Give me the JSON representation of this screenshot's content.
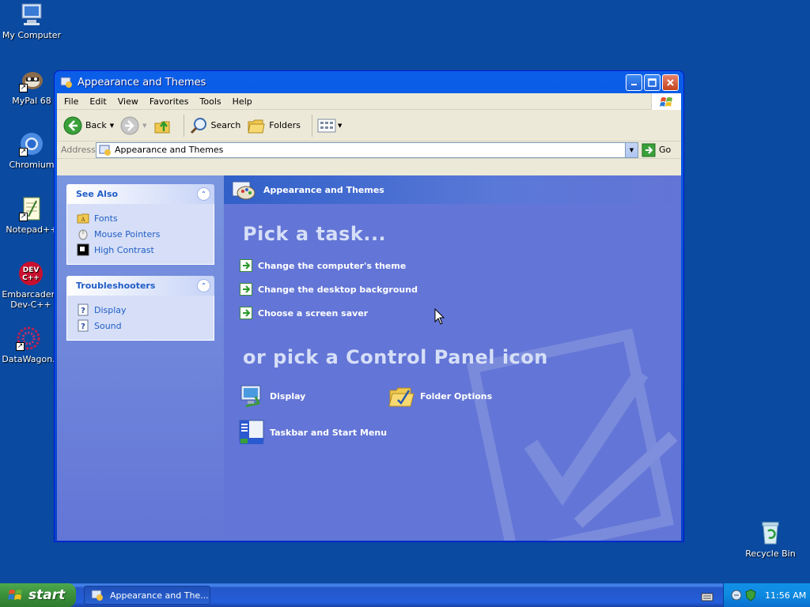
{
  "desktop": {
    "icons": [
      {
        "label": "My Computer"
      },
      {
        "label": "MyPal 68"
      },
      {
        "label": "Chromium"
      },
      {
        "label": "Notepad++"
      },
      {
        "label": "Embarcadero Dev-C++"
      },
      {
        "label": "DataWagon."
      },
      {
        "label": "Recycle Bin"
      }
    ]
  },
  "window": {
    "title": "Appearance and Themes",
    "menu": [
      "File",
      "Edit",
      "View",
      "Favorites",
      "Tools",
      "Help"
    ],
    "toolbar": {
      "back_label": "Back",
      "search_label": "Search",
      "folders_label": "Folders"
    },
    "address": {
      "label": "Address",
      "value": "Appearance and Themes",
      "go_label": "Go"
    },
    "see_also": {
      "title": "See Also",
      "items": [
        "Fonts",
        "Mouse Pointers",
        "High Contrast"
      ]
    },
    "troubleshooters": {
      "title": "Troubleshooters",
      "items": [
        "Display",
        "Sound"
      ]
    },
    "main": {
      "header": "Appearance and Themes",
      "pick_task": "Pick a task...",
      "tasks": [
        "Change the computer's theme",
        "Change the desktop background",
        "Choose a screen saver"
      ],
      "pick_icon": "or pick a Control Panel icon",
      "icons": [
        "Display",
        "Folder Options",
        "Taskbar and Start Menu"
      ]
    }
  },
  "taskbar": {
    "start_label": "start",
    "task_label": "Appearance and The...",
    "clock": "11:56 AM"
  },
  "colors": {
    "desktop": "#0a4aa0",
    "main_pane": "#6375d6",
    "link": "#215dc6"
  }
}
